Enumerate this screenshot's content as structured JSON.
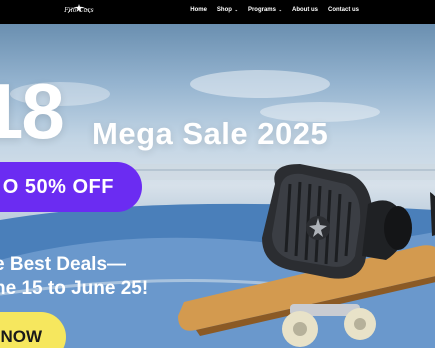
{
  "brand": {
    "logo_text": "Fiio Cars"
  },
  "nav": {
    "items": [
      {
        "label": "Home"
      },
      {
        "label": "Shop",
        "caret": "⌄"
      },
      {
        "label": "Programs",
        "caret": "⌄"
      },
      {
        "label": "About us"
      },
      {
        "label": "Contact us"
      }
    ]
  },
  "hero": {
    "big_number": "18",
    "headline": "Mega Sale 2025",
    "discount": "O 50% OFF",
    "deal_line1": "e Best Deals—",
    "deal_line2": "ne 15 to June 25!",
    "cta": "NOW",
    "colors": {
      "pill": "#6b2cf2",
      "cta": "#f6e75e"
    }
  },
  "icons": [
    "logo-icon",
    "chevron-down-icon",
    "earphone-image",
    "skateboard-image"
  ]
}
